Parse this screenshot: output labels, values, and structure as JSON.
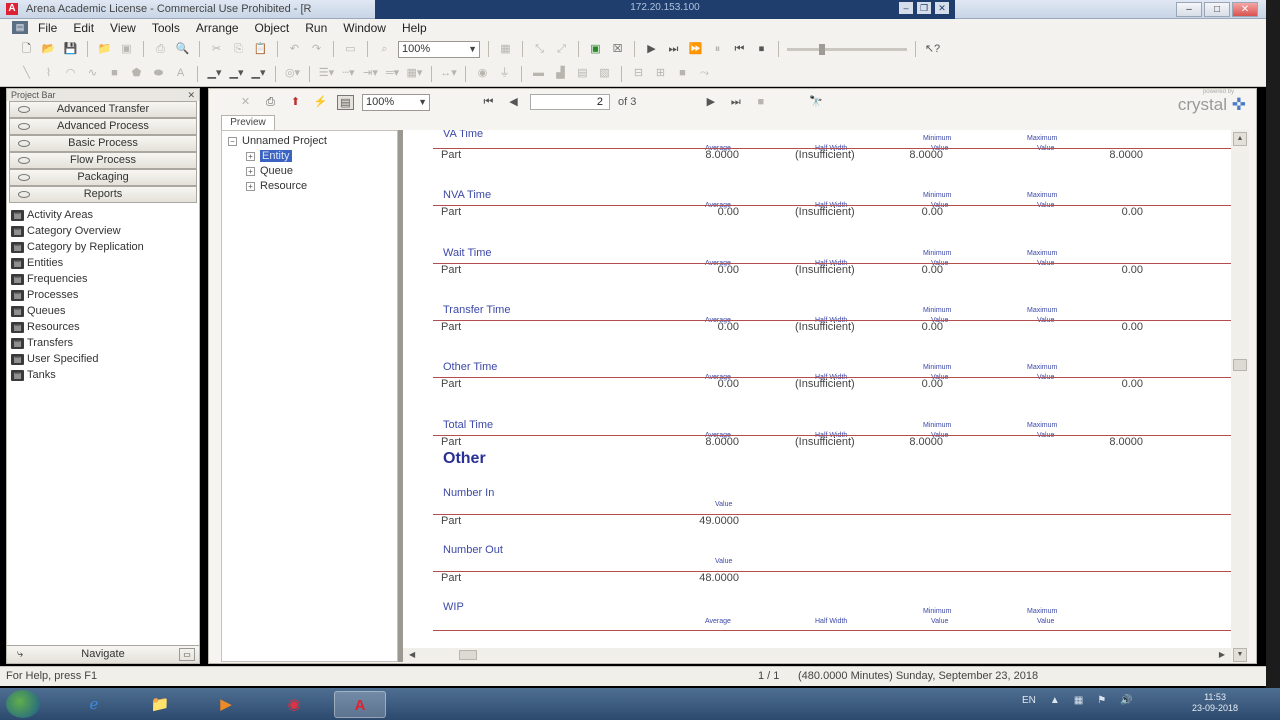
{
  "window": {
    "title": "Arena Academic License - Commercial Use Prohibited - [R",
    "remote_host": "172.20.153.100",
    "controls": {
      "minimize": "–",
      "maximize": "□",
      "close": "✕"
    }
  },
  "menu": [
    "File",
    "Edit",
    "View",
    "Tools",
    "Arrange",
    "Object",
    "Run",
    "Window",
    "Help"
  ],
  "toolbar": {
    "zoom": "100%"
  },
  "project_bar": {
    "header": "Project Bar",
    "panels": [
      "Advanced Transfer",
      "Advanced Process",
      "Basic Process",
      "Flow Process",
      "Packaging",
      "Reports"
    ],
    "reports": [
      "Activity Areas",
      "Category Overview",
      "Category by Replication",
      "Entities",
      "Frequencies",
      "Processes",
      "Queues",
      "Resources",
      "Transfers",
      "User Specified",
      "Tanks"
    ],
    "navigate": "Navigate"
  },
  "viewer": {
    "zoom": "100%",
    "page_current": "2",
    "page_of": "of 3",
    "brand_small": "powered by",
    "brand": "crystal",
    "tab": "Preview",
    "tree": {
      "root": "Unnamed Project",
      "children": [
        "Entity",
        "Queue",
        "Resource"
      ]
    }
  },
  "report": {
    "headers": {
      "average": "Average",
      "half_width": "Half Width",
      "min_1": "Minimum",
      "min_2": "Value",
      "max_1": "Maximum",
      "max_2": "Value",
      "value": "Value"
    },
    "time_sections": [
      {
        "title": "VA Time",
        "row": "Part",
        "average": "8.0000",
        "half_width": "(Insufficient)",
        "min": "8.0000",
        "max": "8.0000"
      },
      {
        "title": "NVA Time",
        "row": "Part",
        "average": "0.00",
        "half_width": "(Insufficient)",
        "min": "0.00",
        "max": "0.00"
      },
      {
        "title": "Wait Time",
        "row": "Part",
        "average": "0.00",
        "half_width": "(Insufficient)",
        "min": "0.00",
        "max": "0.00"
      },
      {
        "title": "Transfer Time",
        "row": "Part",
        "average": "0.00",
        "half_width": "(Insufficient)",
        "min": "0.00",
        "max": "0.00"
      },
      {
        "title": "Other Time",
        "row": "Part",
        "average": "0.00",
        "half_width": "(Insufficient)",
        "min": "0.00",
        "max": "0.00"
      },
      {
        "title": "Total Time",
        "row": "Part",
        "average": "8.0000",
        "half_width": "(Insufficient)",
        "min": "8.0000",
        "max": "8.0000"
      }
    ],
    "other_heading": "Other",
    "value_sections": [
      {
        "title": "Number In",
        "row": "Part",
        "value": "49.0000"
      },
      {
        "title": "Number Out",
        "row": "Part",
        "value": "48.0000"
      }
    ],
    "wip_title": "WIP"
  },
  "status": {
    "help": "For Help, press F1",
    "page": "1 / 1",
    "time": "(480.0000 Minutes) Sunday, September 23, 2018"
  },
  "taskbar": {
    "lang": "EN",
    "clock_time": "11:53",
    "clock_date": "23-09-2018"
  }
}
